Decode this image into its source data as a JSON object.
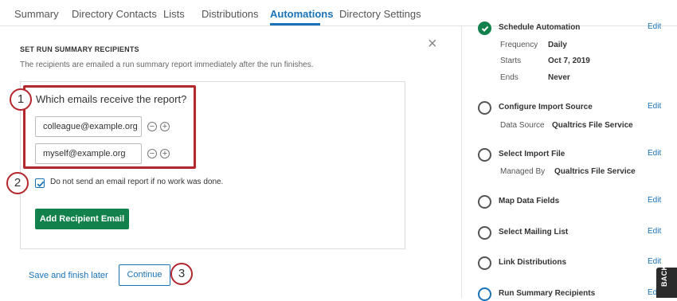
{
  "tabs": [
    {
      "label": "Summary"
    },
    {
      "label": "Directory Contacts"
    },
    {
      "label": "Lists"
    },
    {
      "label": "Distributions"
    },
    {
      "label": "Automations"
    },
    {
      "label": "Directory Settings"
    }
  ],
  "panel": {
    "title": "SET RUN SUMMARY RECIPIENTS",
    "description": "The recipients are emailed a run summary report immediately after the run finishes.",
    "close_icon": "×",
    "question": "Which emails receive the report?",
    "emails": [
      "colleague@example.org",
      "myself@example.org"
    ],
    "remove_icon": "−",
    "add_icon": "+",
    "checkbox_label": "Do not send an email report if no work was done.",
    "checkbox_checked": true,
    "add_button": "Add Recipient Email",
    "save_later": "Save and finish later",
    "continue": "Continue"
  },
  "callouts": [
    "1",
    "2",
    "3"
  ],
  "steps": [
    {
      "title": "Schedule Automation",
      "edit": "Edit",
      "status": "done",
      "details": [
        {
          "key": "Frequency",
          "value": "Daily"
        },
        {
          "key": "Starts",
          "value": "Oct 7, 2019"
        },
        {
          "key": "Ends",
          "value": "Never"
        }
      ]
    },
    {
      "title": "Configure Import Source",
      "edit": "Edit",
      "details": [
        {
          "key": "Data Source",
          "value": "Qualtrics File Service"
        }
      ]
    },
    {
      "title": "Select Import File",
      "edit": "Edit",
      "details": [
        {
          "key": "Managed By",
          "value": "Qualtrics File Service"
        }
      ]
    },
    {
      "title": "Map Data Fields",
      "edit": "Edit",
      "details": []
    },
    {
      "title": "Select Mailing List",
      "edit": "Edit",
      "details": []
    },
    {
      "title": "Link Distributions",
      "edit": "Edit",
      "details": []
    },
    {
      "title": "Run Summary Recipients",
      "edit": "Ed",
      "status": "current",
      "details": []
    }
  ],
  "feedback_tab": "BACK",
  "colors": {
    "accent": "#1a73b8",
    "success": "#13814c",
    "callout": "#b3272d"
  }
}
